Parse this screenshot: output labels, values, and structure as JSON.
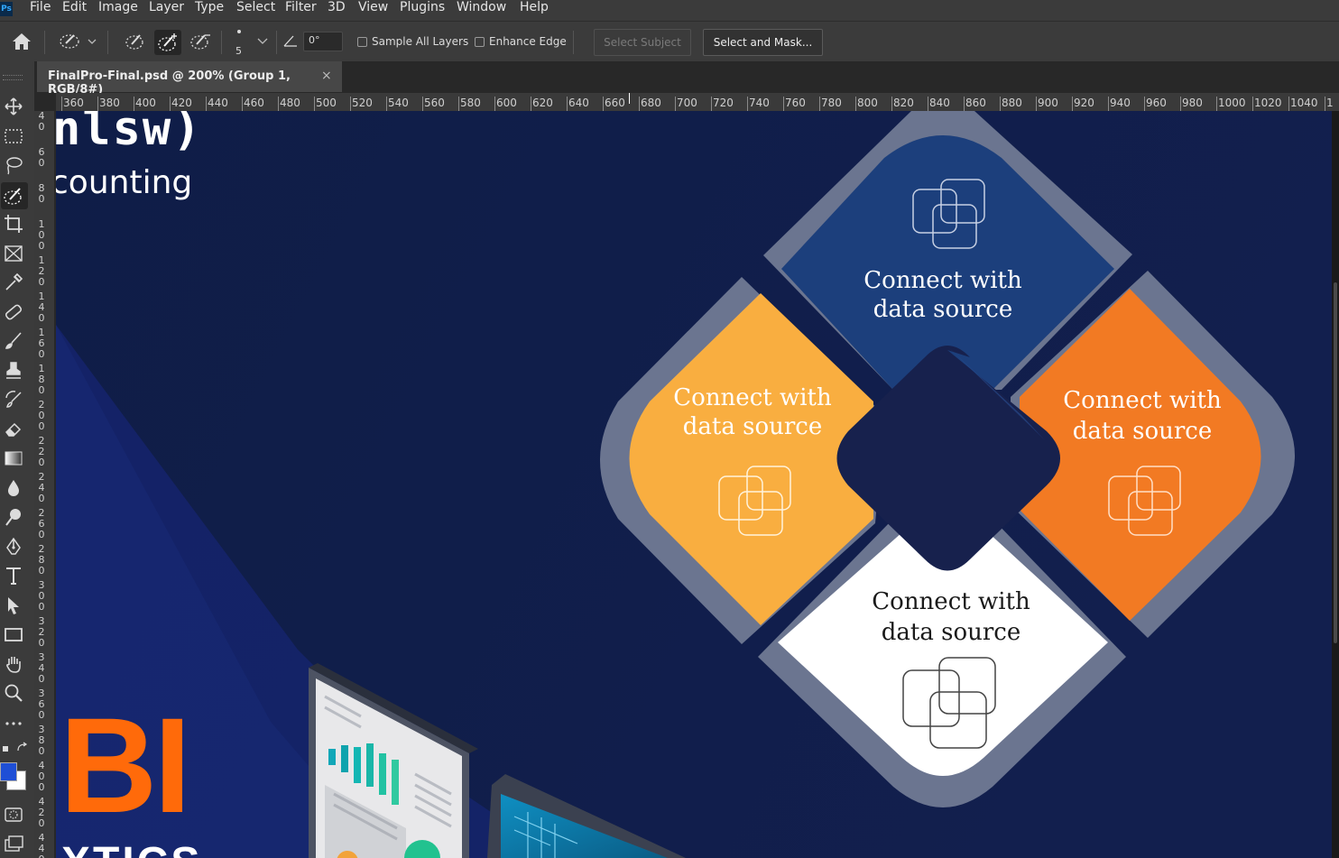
{
  "menubar": {
    "app_badge": "Ps",
    "items": [
      "File",
      "Edit",
      "Image",
      "Layer",
      "Type",
      "Select",
      "Filter",
      "3D",
      "View",
      "Plugins",
      "Window",
      "Help"
    ]
  },
  "options": {
    "brush_size": "5",
    "angle": "0°",
    "sample_all_layers": "Sample All Layers",
    "enhance_edge": "Enhance Edge",
    "select_subject": "Select Subject",
    "select_and_mask": "Select and Mask..."
  },
  "document": {
    "tab_title": "FinalPro-Final.psd @ 200% (Group 1, RGB/8#)",
    "close_glyph": "×"
  },
  "ruler": {
    "ticks": [
      "360",
      "380",
      "400",
      "420",
      "440",
      "460",
      "480",
      "500",
      "520",
      "540",
      "560",
      "580",
      "600",
      "620",
      "640",
      "660",
      "680",
      "700",
      "720",
      "740",
      "760",
      "780",
      "800",
      "820",
      "840",
      "860",
      "880",
      "900",
      "920",
      "940",
      "960",
      "980",
      "1000",
      "1020",
      "1040",
      "1"
    ]
  },
  "vruler": {
    "labels": [
      "40",
      "60",
      "80",
      "100",
      "120",
      "140",
      "160",
      "180",
      "200",
      "220",
      "240",
      "260",
      "280",
      "300",
      "320",
      "340",
      "360",
      "380",
      "400",
      "420",
      "440"
    ]
  },
  "canvas": {
    "logo_fragment": "nlsw)",
    "subtitle_fragment": "counting",
    "bi_text": "BI",
    "bottom_fragment": "XTICS",
    "cards": {
      "top": [
        "Connect with",
        "data source"
      ],
      "left": [
        "Connect with",
        "data source"
      ],
      "right": [
        "Connect with",
        "data source"
      ],
      "bottom": [
        "Connect with",
        "data source"
      ]
    }
  },
  "colors": {
    "canvas_bg": "#111f49",
    "card_top": "#1c3f7c",
    "card_left": "#f9ae40",
    "card_right": "#f27a23",
    "card_bottom": "#ffffff",
    "frame": "#6b7590",
    "center": "#17214d",
    "bi_orange": "#ff6a0a",
    "fg_swatch": "#1f4fd6",
    "bg_swatch": "#ffffff"
  }
}
